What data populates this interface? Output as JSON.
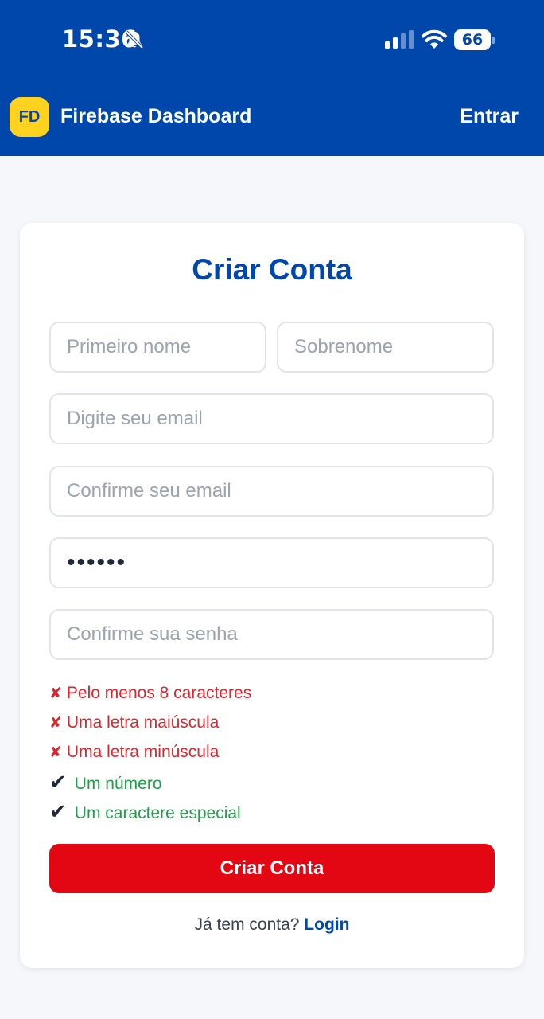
{
  "status_bar": {
    "time": "15:36",
    "battery": "66",
    "icons": [
      "bell-slash-icon",
      "signal-icon",
      "wifi-icon",
      "battery-icon"
    ]
  },
  "header": {
    "logo_text": "FD",
    "title": "Firebase Dashboard",
    "login_label": "Entrar"
  },
  "form": {
    "title": "Criar Conta",
    "fields": {
      "first_name": {
        "placeholder": "Primeiro nome",
        "value": ""
      },
      "last_name": {
        "placeholder": "Sobrenome",
        "value": ""
      },
      "email": {
        "placeholder": "Digite seu email",
        "value": ""
      },
      "confirm_email": {
        "placeholder": "Confirme seu email",
        "value": ""
      },
      "password": {
        "placeholder": "",
        "value": "••••••"
      },
      "confirm_password": {
        "placeholder": "Confirme sua senha",
        "value": ""
      }
    },
    "password_rules": [
      {
        "label": "Pelo menos 8 caracteres",
        "status": "fail",
        "icon": "✘"
      },
      {
        "label": "Uma letra maiúscula",
        "status": "fail",
        "icon": "✘"
      },
      {
        "label": "Uma letra minúscula",
        "status": "fail",
        "icon": "✘"
      },
      {
        "label": "Um número",
        "status": "pass",
        "icon": "✔"
      },
      {
        "label": "Um caractere especial",
        "status": "pass",
        "icon": "✔"
      }
    ],
    "submit_label": "Criar Conta",
    "footer_prompt": "Já tem conta?",
    "footer_link": "Login"
  },
  "colors": {
    "brand_blue": "#0047ab",
    "accent_yellow": "#ffd21f",
    "error_red": "#d9262e",
    "success_green": "#1e9e48",
    "button_red": "#e30613"
  }
}
